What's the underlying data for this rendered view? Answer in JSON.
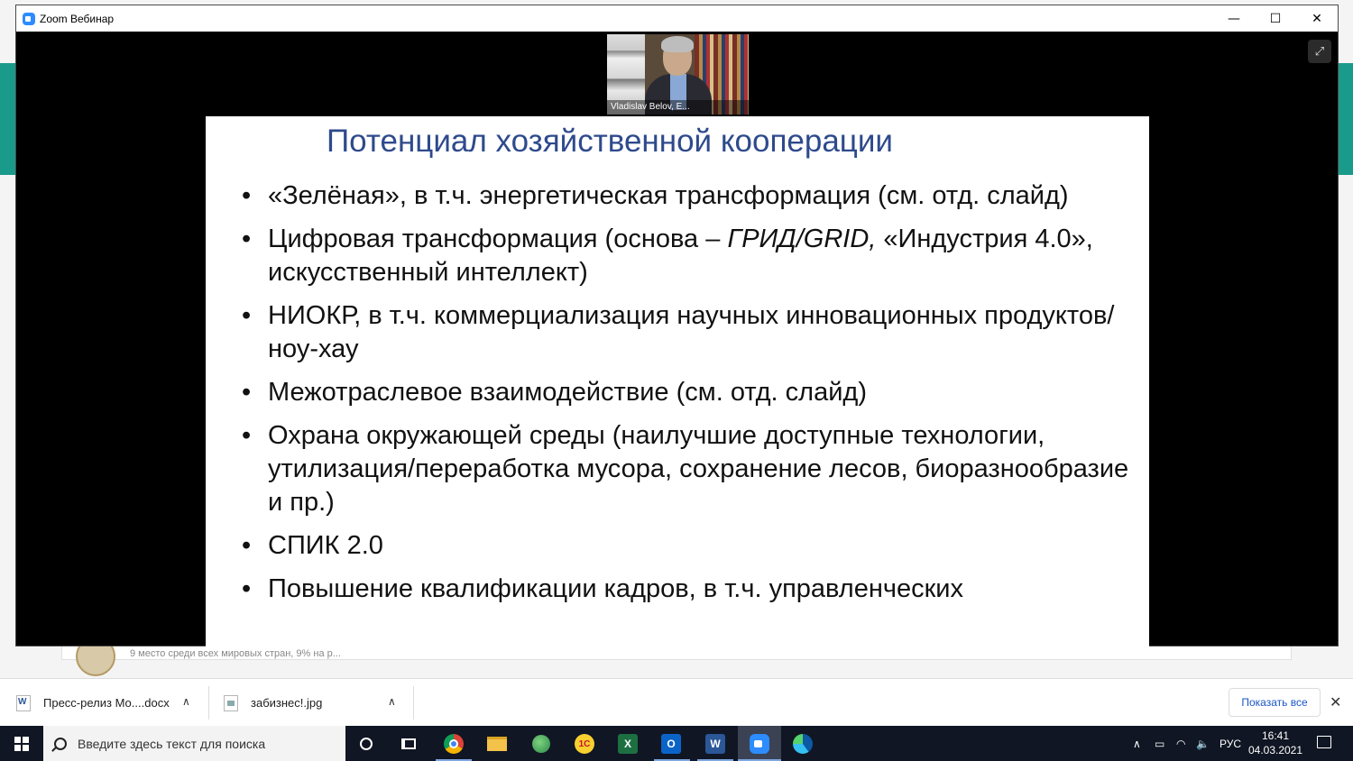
{
  "zoom": {
    "window_title": "Zoom Вебинар",
    "controls": {
      "minimize": "—",
      "maximize": "☐",
      "close": "✕"
    },
    "speaker_name": "Vladislav Belov, E...",
    "expand_icon": "⤢"
  },
  "slide": {
    "title": "Потенциал хозяйственной кооперации",
    "bullets": [
      {
        "text": "«Зелёная», в т.ч. энергетическая трансформация (см. отд. слайд)"
      },
      {
        "text_a": "Цифровая трансформация (основа – ",
        "text_it": "ГРИД/GRID,",
        "text_b": " «Индустрия 4.0», искусственный интеллект)"
      },
      {
        "text": "НИОКР, в т.ч. коммерциализация научных инновационных продуктов/ноу-хау"
      },
      {
        "text": "Межотраслевое взаимодействие (см. отд. слайд)"
      },
      {
        "text": "Охрана окружающей среды (наилучшие доступные технологии, утилизация/переработка мусора, сохранение лесов, биоразнообразие и пр.)"
      },
      {
        "text": "СПИК 2.0"
      },
      {
        "text": "Повышение квалификации кадров, в т.ч. управленческих"
      }
    ]
  },
  "background_page": {
    "snippet": "9 место среди всех мировых стран, 9% на р..."
  },
  "downloads": {
    "items": [
      {
        "name": "Пресс-релиз Мо....docx",
        "icon": "word-doc-icon"
      },
      {
        "name": "забизнес!.jpg",
        "icon": "image-file-icon"
      }
    ],
    "show_all": "Показать все",
    "close": "✕",
    "chevron": "∧"
  },
  "taskbar": {
    "search_placeholder": "Введите здесь текст для поиска",
    "icon_1c": "1С",
    "icon_excel": "X",
    "icon_outlook": "O",
    "icon_word": "W",
    "language": "РУС",
    "time": "16:41",
    "date": "04.03.2021",
    "tray_symbols": {
      "chevron": "∧",
      "battery": "▭",
      "network": "◠",
      "volume": "🔈"
    }
  },
  "colors": {
    "slide_title": "#2e4a8c",
    "zoom_blue": "#2d8cff",
    "taskbar_bg": "#101623",
    "teal": "#1a9a8a"
  }
}
